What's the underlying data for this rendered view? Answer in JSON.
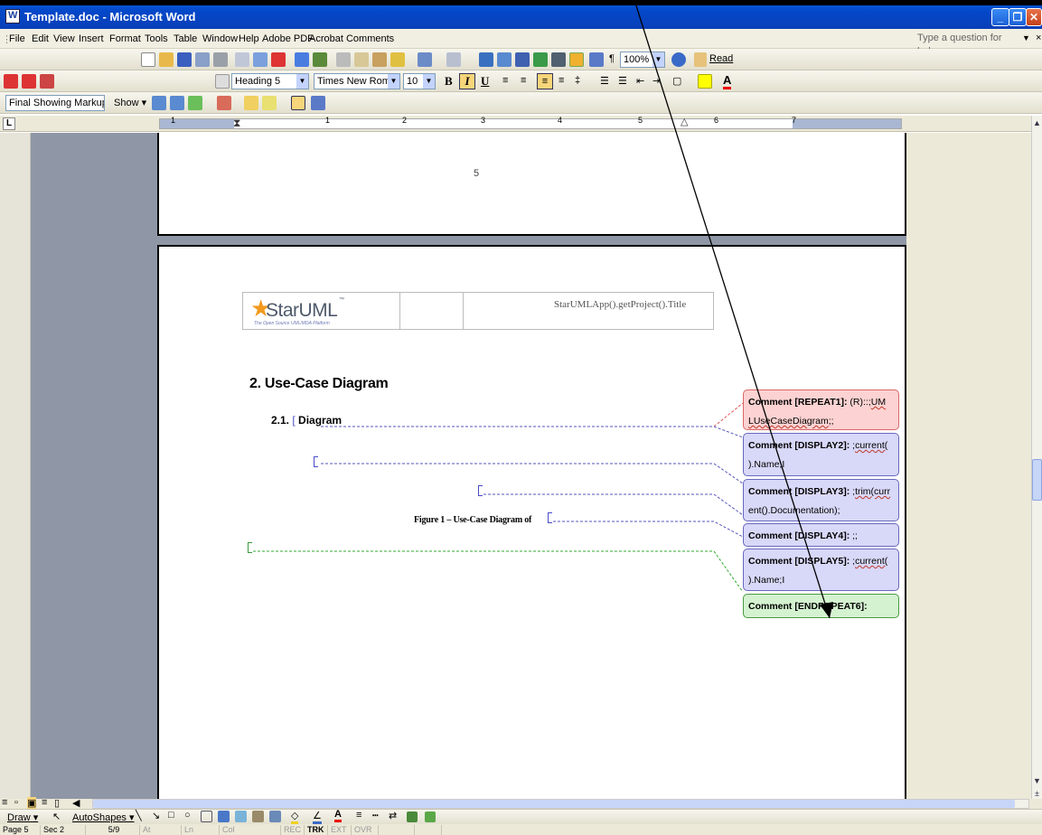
{
  "window": {
    "title": "Template.doc - Microsoft Word"
  },
  "menubar": {
    "items": [
      "File",
      "Edit",
      "View",
      "Insert",
      "Format",
      "Tools",
      "Table",
      "Window",
      "Help",
      "Adobe PDF",
      "Acrobat Comments"
    ],
    "help_placeholder": "Type a question for help",
    "close_doc": "×"
  },
  "standard_toolbar": {
    "zoom": "100%",
    "read_label": "Read"
  },
  "formatting_toolbar": {
    "style": "Heading 5",
    "font": "Times New Roman",
    "size": "10",
    "bold": "B",
    "italic": "I",
    "underline": "U"
  },
  "reviewing_toolbar": {
    "markup": "Final Showing Markup",
    "show_label": "Show"
  },
  "ruler": {
    "numbers": [
      "1",
      "1",
      "2",
      "3",
      "4",
      "5",
      "6",
      "7"
    ]
  },
  "document": {
    "page_number": "5",
    "header_title": "StarUMLApp().getProject().Title",
    "logo": {
      "word": "StarUML",
      "tm": "™",
      "tagline": "The Open Source UML/MDA Platform"
    },
    "heading1": "2.  Use-Case Diagram",
    "heading2": "2.1.",
    "heading2_text": "Diagram",
    "caption": "Figure 1 – Use-Case Diagram of"
  },
  "comments": [
    {
      "label": "Comment [REPEAT1]:",
      "text_a": "(R)::;",
      "text_b": "UM",
      "text_c": "LUseCaseDiagram",
      "text_d": ";;"
    },
    {
      "label": "Comment [DISPLAY2]:",
      "text_a": ";",
      "text_b": "current(",
      "text_c": ").Name;I"
    },
    {
      "label": "Comment [DISPLAY3]:",
      "text_a": ";",
      "text_b": "trim(curr",
      "text_c": "ent().Documentation);"
    },
    {
      "label": "Comment [DISPLAY4]:",
      "text_a": ";;"
    },
    {
      "label": "Comment [DISPLAY5]:",
      "text_a": ";",
      "text_b": "current(",
      "text_c": ").Name;I"
    },
    {
      "label": "Comment [ENDREPEAT6]:"
    }
  ],
  "drawing_toolbar": {
    "draw": "Draw",
    "autoshapes": "AutoShapes"
  },
  "statusbar": {
    "page": "Page 5",
    "sec": "Sec 2",
    "pages": "5/9",
    "at": "At",
    "ln": "Ln",
    "col": "Col",
    "rec": "REC",
    "trk": "TRK",
    "ext": "EXT",
    "ovr": "OVR"
  },
  "colors": {
    "titlebar": "#0347c8",
    "repeat_balloon": "#fcd2d2",
    "display_balloon": "#d8d8f8",
    "endrepeat_balloon": "#d4f2d0"
  }
}
